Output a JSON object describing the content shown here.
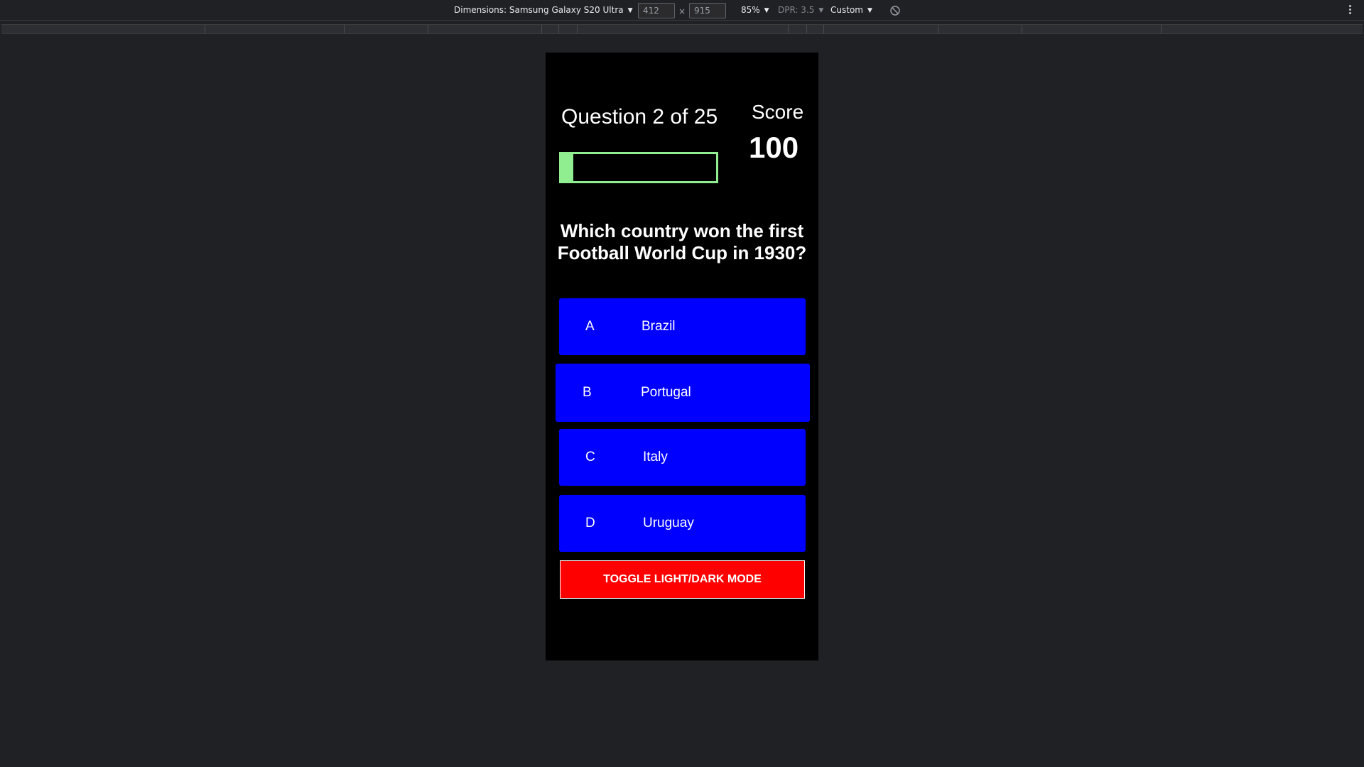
{
  "toolbar": {
    "dimensions_label": "Dimensions: Samsung Galaxy S20 Ultra",
    "width_value": "412",
    "height_value": "915",
    "times_symbol": "×",
    "zoom_label": "85%",
    "dpr_label": "DPR: 3.5",
    "throttle_label": "Custom",
    "caret": "▼",
    "icons": {
      "dimensions_dropdown": "chevron-down-icon",
      "rotate": "rotate-icon",
      "more": "more-vertical-icon"
    }
  },
  "quiz": {
    "question_counter": "Question 2 of 25",
    "progress": {
      "current": 2,
      "total": 25
    },
    "score_label": "Score",
    "score_value": "100",
    "question": "Which country won the first Football World Cup in 1930?",
    "choices": [
      {
        "prefix": "A",
        "text": "Brazil"
      },
      {
        "prefix": "B",
        "text": "Portugal"
      },
      {
        "prefix": "C",
        "text": "Italy"
      },
      {
        "prefix": "D",
        "text": "Uruguay"
      }
    ],
    "toggle_label": "TOGGLE LIGHT/DARK MODE"
  },
  "colors": {
    "page_background": "#202124",
    "viewport_background": "#000000",
    "progress_color": "#90ee90",
    "choice_background": "#0000ff",
    "toggle_background": "#ff0000",
    "text": "#ffffff"
  }
}
